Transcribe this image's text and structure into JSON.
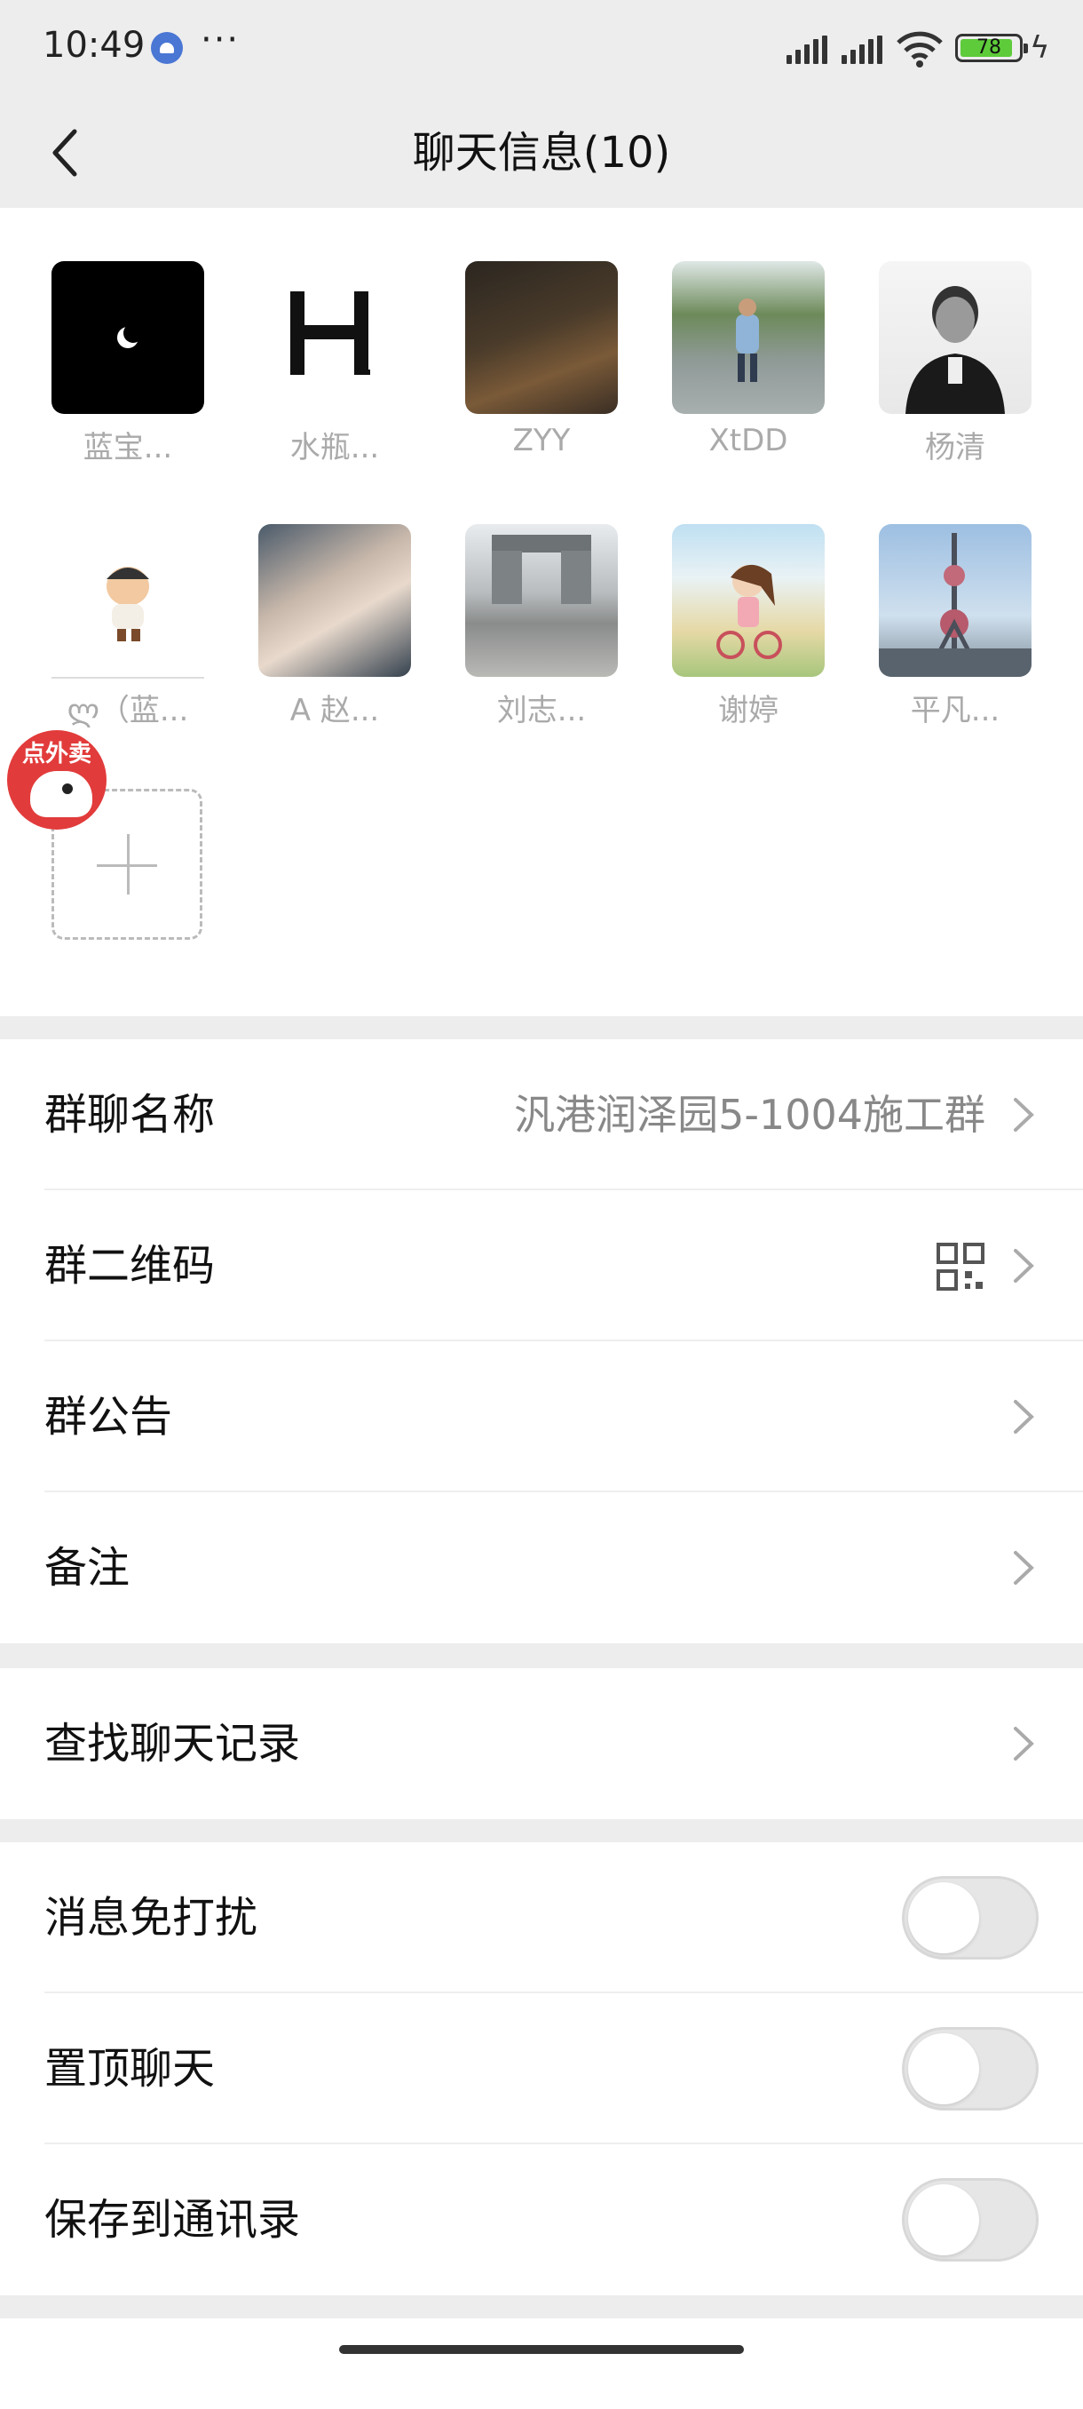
{
  "status_bar": {
    "time": "10:49",
    "dots": "···",
    "battery": "78"
  },
  "nav": {
    "title": "聊天信息(10)"
  },
  "members": [
    {
      "name": "蓝宝..."
    },
    {
      "name": "水瓶..."
    },
    {
      "name": "ZYY"
    },
    {
      "name": "XtDD"
    },
    {
      "name": "杨清"
    },
    {
      "name": "ლ（蓝..."
    },
    {
      "name": "A 赵..."
    },
    {
      "name": "刘志..."
    },
    {
      "name": "谢婷"
    },
    {
      "name": "平凡..."
    }
  ],
  "float_ad": {
    "text": "点外卖"
  },
  "group1": {
    "name_label": "群聊名称",
    "name_value": "汎港润泽园5-1004施工群",
    "qrcode_label": "群二维码",
    "notice_label": "群公告",
    "remark_label": "备注"
  },
  "group2": {
    "search_label": "查找聊天记录"
  },
  "group3": {
    "mute_label": "消息免打扰",
    "mute_on": false,
    "pin_label": "置顶聊天",
    "pin_on": false,
    "save_label": "保存到通讯录",
    "save_on": false
  }
}
